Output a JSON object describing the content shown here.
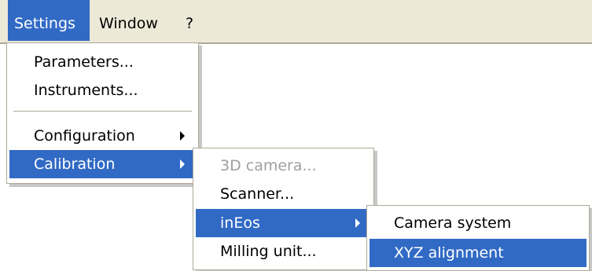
{
  "menubar": {
    "items": [
      {
        "label": "Settings"
      },
      {
        "label": "Window"
      },
      {
        "label": "?"
      }
    ]
  },
  "settings_menu": {
    "items": [
      {
        "label": "Parameters..."
      },
      {
        "label": "Instruments..."
      },
      {
        "label": "Configuration"
      },
      {
        "label": "Calibration"
      }
    ]
  },
  "calibration_menu": {
    "items": [
      {
        "label": "3D camera..."
      },
      {
        "label": "Scanner..."
      },
      {
        "label": "inEos"
      },
      {
        "label": "Milling unit..."
      }
    ]
  },
  "ineos_menu": {
    "items": [
      {
        "label": "Camera system"
      },
      {
        "label": "XYZ alignment"
      }
    ]
  },
  "colors": {
    "highlight": "#316ac5",
    "menubar_bg": "#ece9d8",
    "disabled_text": "#a0a0a0"
  }
}
